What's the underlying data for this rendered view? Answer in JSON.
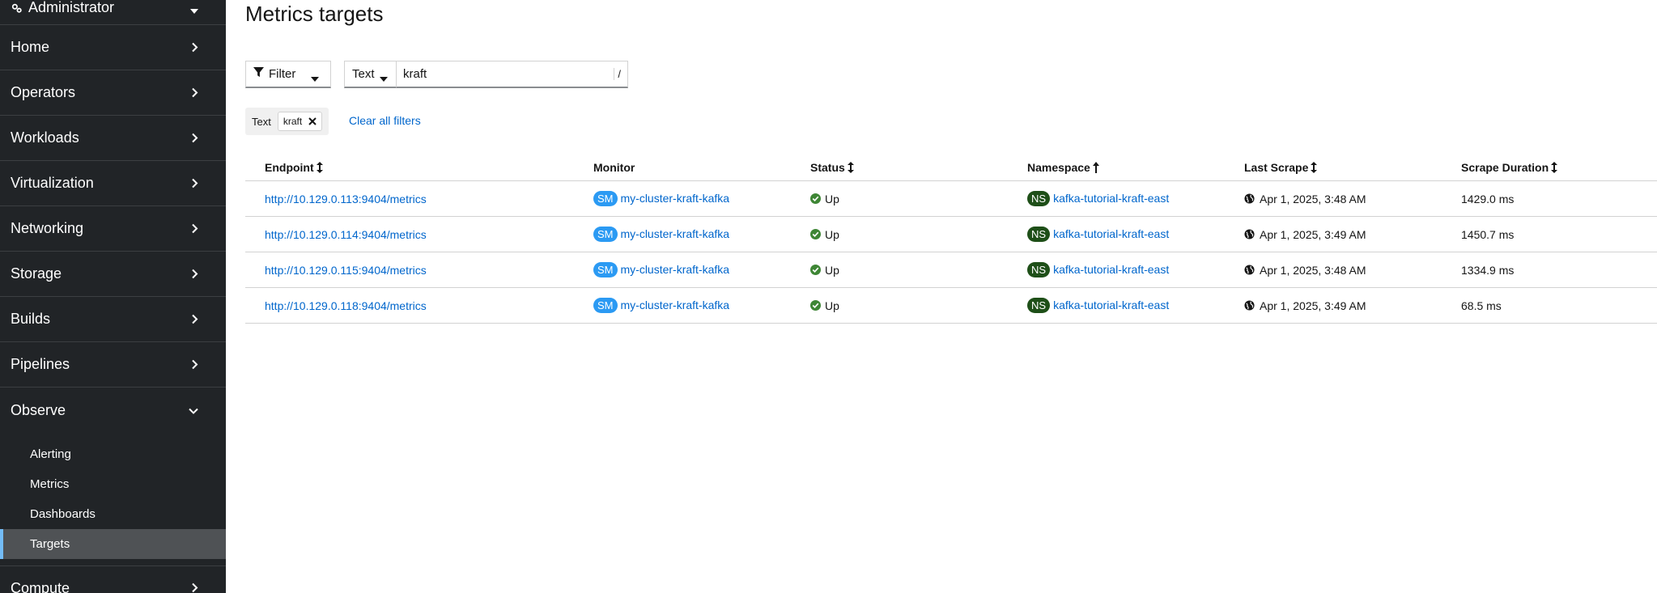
{
  "sidebar": {
    "perspective": "Administrator",
    "sections": [
      {
        "label": "Home"
      },
      {
        "label": "Operators"
      },
      {
        "label": "Workloads"
      },
      {
        "label": "Virtualization"
      },
      {
        "label": "Networking"
      },
      {
        "label": "Storage"
      },
      {
        "label": "Builds"
      },
      {
        "label": "Pipelines"
      },
      {
        "label": "Observe"
      }
    ],
    "observe_items": [
      {
        "label": "Alerting"
      },
      {
        "label": "Metrics"
      },
      {
        "label": "Dashboards"
      },
      {
        "label": "Targets"
      }
    ],
    "compute_label": "Compute"
  },
  "page": {
    "title": "Metrics targets"
  },
  "toolbar": {
    "filter_label": "Filter",
    "filter_type": "Text",
    "search_value": "kraft",
    "search_shortcut": "/"
  },
  "chips": {
    "category": "Text",
    "value": "kraft",
    "clear_all": "Clear all filters"
  },
  "table": {
    "headers": [
      "Endpoint",
      "Monitor",
      "Status",
      "Namespace",
      "Last Scrape",
      "Scrape Duration"
    ],
    "rows": [
      {
        "endpoint": "http://10.129.0.113:9404/metrics",
        "monitor_badge": "SM",
        "monitor": "my-cluster-kraft-kafka",
        "status": "Up",
        "ns_badge": "NS",
        "namespace": "kafka-tutorial-kraft-east",
        "last_scrape": "Apr 1, 2025, 3:48 AM",
        "duration": "1429.0 ms"
      },
      {
        "endpoint": "http://10.129.0.114:9404/metrics",
        "monitor_badge": "SM",
        "monitor": "my-cluster-kraft-kafka",
        "status": "Up",
        "ns_badge": "NS",
        "namespace": "kafka-tutorial-kraft-east",
        "last_scrape": "Apr 1, 2025, 3:49 AM",
        "duration": "1450.7 ms"
      },
      {
        "endpoint": "http://10.129.0.115:9404/metrics",
        "monitor_badge": "SM",
        "monitor": "my-cluster-kraft-kafka",
        "status": "Up",
        "ns_badge": "NS",
        "namespace": "kafka-tutorial-kraft-east",
        "last_scrape": "Apr 1, 2025, 3:48 AM",
        "duration": "1334.9 ms"
      },
      {
        "endpoint": "http://10.129.0.118:9404/metrics",
        "monitor_badge": "SM",
        "monitor": "my-cluster-kraft-kafka",
        "status": "Up",
        "ns_badge": "NS",
        "namespace": "kafka-tutorial-kraft-east",
        "last_scrape": "Apr 1, 2025, 3:49 AM",
        "duration": "68.5 ms"
      }
    ]
  },
  "colors": {
    "sidebar_bg": "#212427",
    "link": "#0066cc",
    "status_ok": "#3e8635",
    "sm_badge": "#2b9af3",
    "ns_badge": "#1e4f18",
    "active_indicator": "#73bcf7"
  }
}
